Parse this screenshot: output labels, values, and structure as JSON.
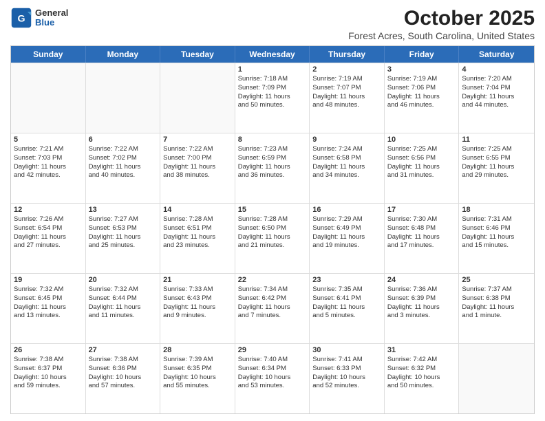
{
  "header": {
    "logo_general": "General",
    "logo_blue": "Blue",
    "month_year": "October 2025",
    "location": "Forest Acres, South Carolina, United States"
  },
  "weekdays": [
    "Sunday",
    "Monday",
    "Tuesday",
    "Wednesday",
    "Thursday",
    "Friday",
    "Saturday"
  ],
  "rows": [
    [
      {
        "day": "",
        "info": "",
        "empty": true
      },
      {
        "day": "",
        "info": "",
        "empty": true
      },
      {
        "day": "",
        "info": "",
        "empty": true
      },
      {
        "day": "1",
        "info": "Sunrise: 7:18 AM\nSunset: 7:09 PM\nDaylight: 11 hours\nand 50 minutes.",
        "empty": false
      },
      {
        "day": "2",
        "info": "Sunrise: 7:19 AM\nSunset: 7:07 PM\nDaylight: 11 hours\nand 48 minutes.",
        "empty": false
      },
      {
        "day": "3",
        "info": "Sunrise: 7:19 AM\nSunset: 7:06 PM\nDaylight: 11 hours\nand 46 minutes.",
        "empty": false
      },
      {
        "day": "4",
        "info": "Sunrise: 7:20 AM\nSunset: 7:04 PM\nDaylight: 11 hours\nand 44 minutes.",
        "empty": false
      }
    ],
    [
      {
        "day": "5",
        "info": "Sunrise: 7:21 AM\nSunset: 7:03 PM\nDaylight: 11 hours\nand 42 minutes.",
        "empty": false
      },
      {
        "day": "6",
        "info": "Sunrise: 7:22 AM\nSunset: 7:02 PM\nDaylight: 11 hours\nand 40 minutes.",
        "empty": false
      },
      {
        "day": "7",
        "info": "Sunrise: 7:22 AM\nSunset: 7:00 PM\nDaylight: 11 hours\nand 38 minutes.",
        "empty": false
      },
      {
        "day": "8",
        "info": "Sunrise: 7:23 AM\nSunset: 6:59 PM\nDaylight: 11 hours\nand 36 minutes.",
        "empty": false
      },
      {
        "day": "9",
        "info": "Sunrise: 7:24 AM\nSunset: 6:58 PM\nDaylight: 11 hours\nand 34 minutes.",
        "empty": false
      },
      {
        "day": "10",
        "info": "Sunrise: 7:25 AM\nSunset: 6:56 PM\nDaylight: 11 hours\nand 31 minutes.",
        "empty": false
      },
      {
        "day": "11",
        "info": "Sunrise: 7:25 AM\nSunset: 6:55 PM\nDaylight: 11 hours\nand 29 minutes.",
        "empty": false
      }
    ],
    [
      {
        "day": "12",
        "info": "Sunrise: 7:26 AM\nSunset: 6:54 PM\nDaylight: 11 hours\nand 27 minutes.",
        "empty": false
      },
      {
        "day": "13",
        "info": "Sunrise: 7:27 AM\nSunset: 6:53 PM\nDaylight: 11 hours\nand 25 minutes.",
        "empty": false
      },
      {
        "day": "14",
        "info": "Sunrise: 7:28 AM\nSunset: 6:51 PM\nDaylight: 11 hours\nand 23 minutes.",
        "empty": false
      },
      {
        "day": "15",
        "info": "Sunrise: 7:28 AM\nSunset: 6:50 PM\nDaylight: 11 hours\nand 21 minutes.",
        "empty": false
      },
      {
        "day": "16",
        "info": "Sunrise: 7:29 AM\nSunset: 6:49 PM\nDaylight: 11 hours\nand 19 minutes.",
        "empty": false
      },
      {
        "day": "17",
        "info": "Sunrise: 7:30 AM\nSunset: 6:48 PM\nDaylight: 11 hours\nand 17 minutes.",
        "empty": false
      },
      {
        "day": "18",
        "info": "Sunrise: 7:31 AM\nSunset: 6:46 PM\nDaylight: 11 hours\nand 15 minutes.",
        "empty": false
      }
    ],
    [
      {
        "day": "19",
        "info": "Sunrise: 7:32 AM\nSunset: 6:45 PM\nDaylight: 11 hours\nand 13 minutes.",
        "empty": false
      },
      {
        "day": "20",
        "info": "Sunrise: 7:32 AM\nSunset: 6:44 PM\nDaylight: 11 hours\nand 11 minutes.",
        "empty": false
      },
      {
        "day": "21",
        "info": "Sunrise: 7:33 AM\nSunset: 6:43 PM\nDaylight: 11 hours\nand 9 minutes.",
        "empty": false
      },
      {
        "day": "22",
        "info": "Sunrise: 7:34 AM\nSunset: 6:42 PM\nDaylight: 11 hours\nand 7 minutes.",
        "empty": false
      },
      {
        "day": "23",
        "info": "Sunrise: 7:35 AM\nSunset: 6:41 PM\nDaylight: 11 hours\nand 5 minutes.",
        "empty": false
      },
      {
        "day": "24",
        "info": "Sunrise: 7:36 AM\nSunset: 6:39 PM\nDaylight: 11 hours\nand 3 minutes.",
        "empty": false
      },
      {
        "day": "25",
        "info": "Sunrise: 7:37 AM\nSunset: 6:38 PM\nDaylight: 11 hours\nand 1 minute.",
        "empty": false
      }
    ],
    [
      {
        "day": "26",
        "info": "Sunrise: 7:38 AM\nSunset: 6:37 PM\nDaylight: 10 hours\nand 59 minutes.",
        "empty": false
      },
      {
        "day": "27",
        "info": "Sunrise: 7:38 AM\nSunset: 6:36 PM\nDaylight: 10 hours\nand 57 minutes.",
        "empty": false
      },
      {
        "day": "28",
        "info": "Sunrise: 7:39 AM\nSunset: 6:35 PM\nDaylight: 10 hours\nand 55 minutes.",
        "empty": false
      },
      {
        "day": "29",
        "info": "Sunrise: 7:40 AM\nSunset: 6:34 PM\nDaylight: 10 hours\nand 53 minutes.",
        "empty": false
      },
      {
        "day": "30",
        "info": "Sunrise: 7:41 AM\nSunset: 6:33 PM\nDaylight: 10 hours\nand 52 minutes.",
        "empty": false
      },
      {
        "day": "31",
        "info": "Sunrise: 7:42 AM\nSunset: 6:32 PM\nDaylight: 10 hours\nand 50 minutes.",
        "empty": false
      },
      {
        "day": "",
        "info": "",
        "empty": true
      }
    ]
  ]
}
